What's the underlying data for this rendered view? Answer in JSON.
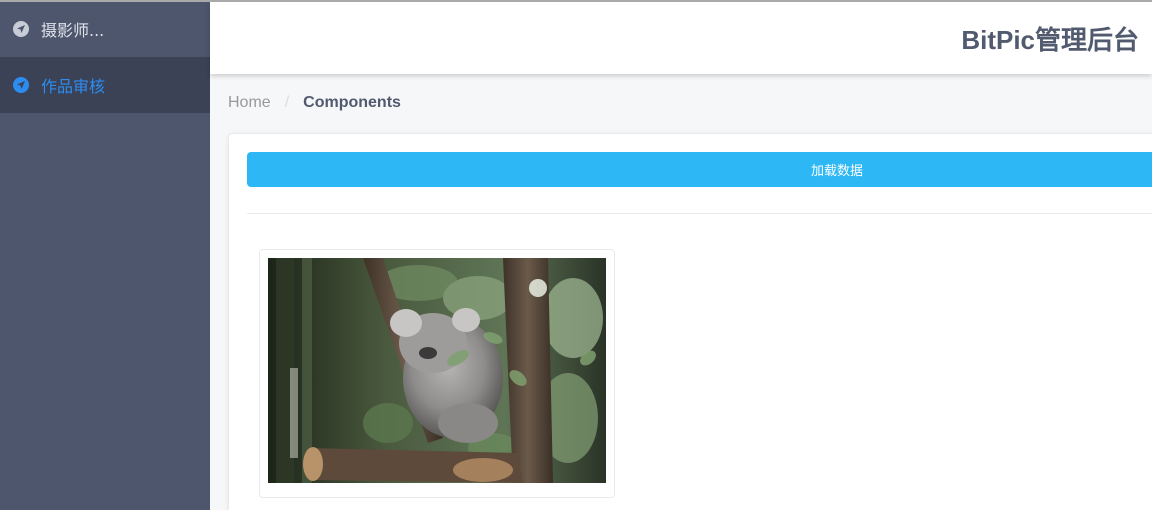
{
  "sidebar": {
    "items": [
      {
        "label": "摄影师...",
        "icon": "navigation-icon",
        "active": false
      },
      {
        "label": "作品审核",
        "icon": "navigation-icon",
        "active": true
      }
    ]
  },
  "header": {
    "title": "BitPic管理后台"
  },
  "breadcrumb": {
    "home": "Home",
    "separator": "/",
    "current": "Components"
  },
  "main": {
    "load_button_label": "加载数据",
    "photos": [
      {
        "subject": "koala sleeping in a tree"
      }
    ]
  },
  "colors": {
    "sidebar_bg": "#4d566d",
    "sidebar_active_bg": "#3b4256",
    "accent": "#2d8cf0",
    "button": "#2db7f5",
    "title": "#515a6e"
  }
}
